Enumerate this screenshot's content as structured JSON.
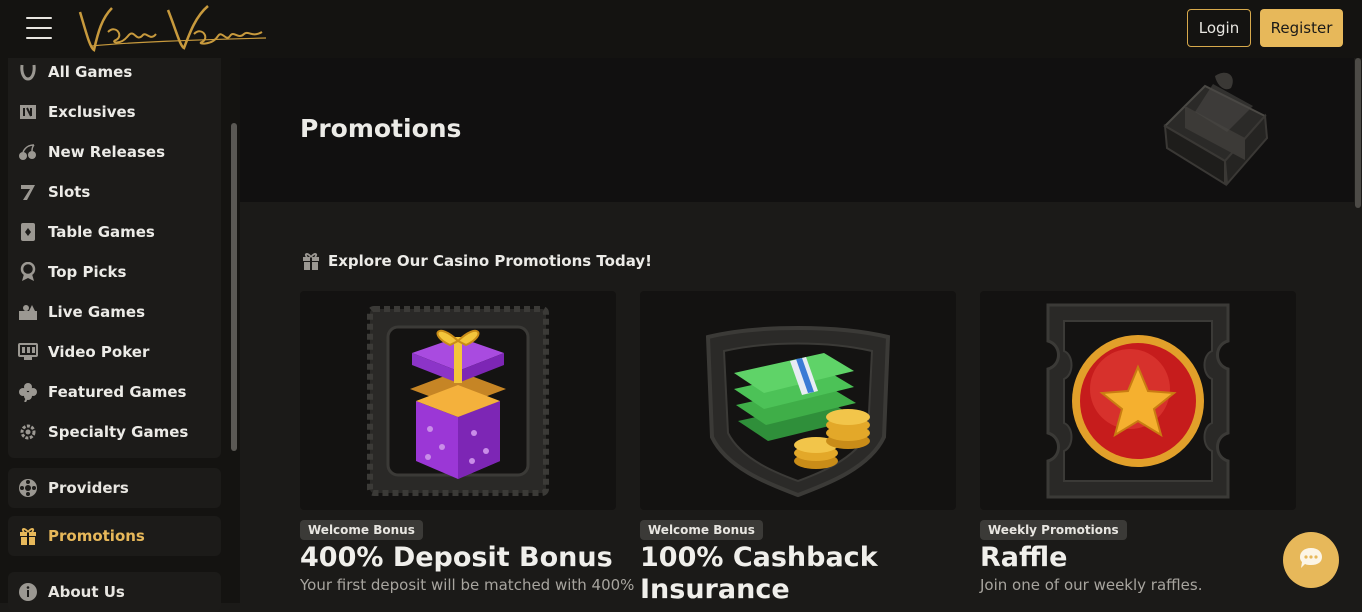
{
  "header": {
    "logo_text": "New Vegas",
    "login_label": "Login",
    "register_label": "Register"
  },
  "sidebar": {
    "games": [
      {
        "label": "All Games",
        "icon": "horseshoe-icon"
      },
      {
        "label": "Exclusives",
        "icon": "exclusive-icon"
      },
      {
        "label": "New Releases",
        "icon": "cherries-icon"
      },
      {
        "label": "Slots",
        "icon": "seven-icon"
      },
      {
        "label": "Table Games",
        "icon": "card-icon"
      },
      {
        "label": "Top Picks",
        "icon": "award-icon"
      },
      {
        "label": "Live Games",
        "icon": "live-dealer-icon"
      },
      {
        "label": "Video Poker",
        "icon": "video-poker-icon"
      },
      {
        "label": "Featured Games",
        "icon": "clover-icon"
      },
      {
        "label": "Specialty Games",
        "icon": "gear-icon"
      }
    ],
    "providers_label": "Providers",
    "promotions_label": "Promotions",
    "about_label": "About Us"
  },
  "hero": {
    "title": "Promotions"
  },
  "section": {
    "title": "Explore Our Casino Promotions Today!"
  },
  "cards": [
    {
      "badge": "Welcome Bonus",
      "title": "400% Deposit Bonus",
      "desc": "Your first deposit will be matched with 400%"
    },
    {
      "badge": "Welcome Bonus",
      "title": "100% Cashback Insurance",
      "desc": ""
    },
    {
      "badge": "Weekly Promotions",
      "title": "Raffle",
      "desc": "Join one of our weekly raffles."
    }
  ],
  "colors": {
    "accent": "#e7b85a",
    "background": "#1b1a18",
    "panel": "#141311"
  }
}
